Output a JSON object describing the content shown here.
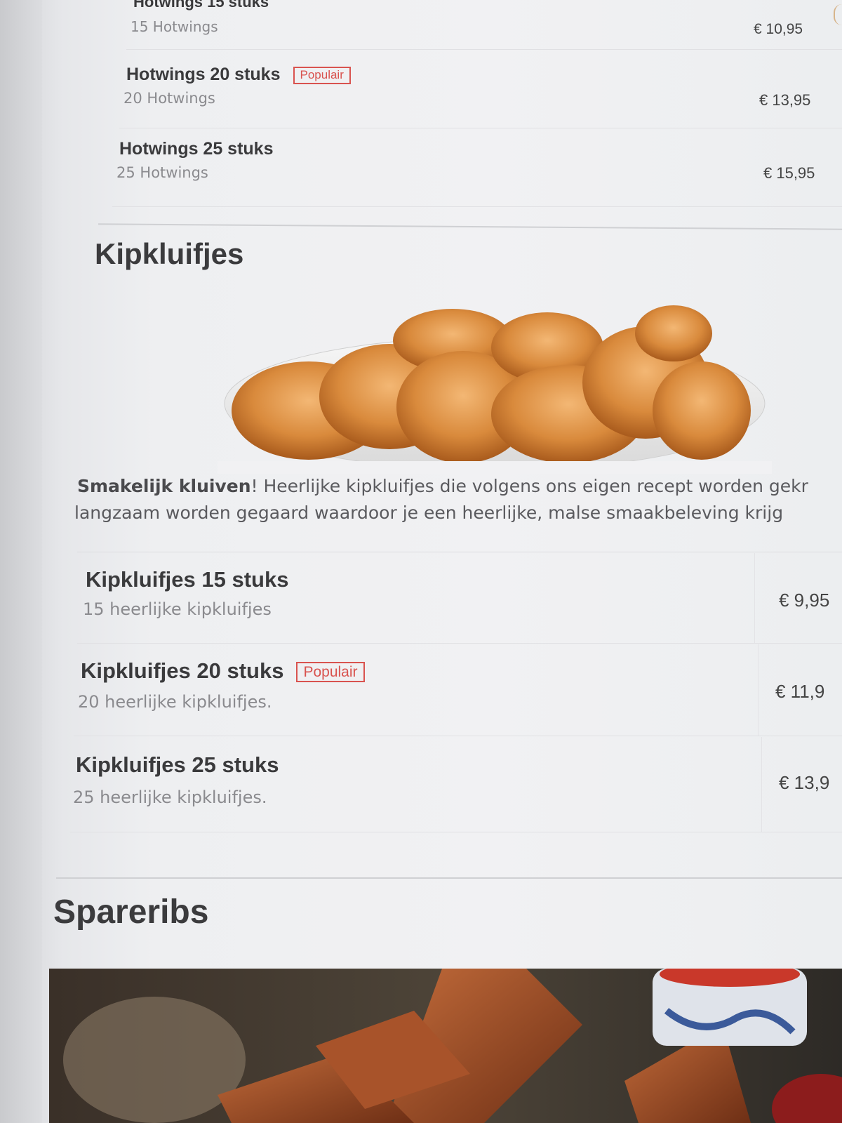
{
  "hotwings": {
    "items": [
      {
        "name": "Hotwings 15 stuks",
        "desc": "15 Hotwings",
        "price": "€ 10,95",
        "badge": ""
      },
      {
        "name": "Hotwings 20 stuks",
        "desc": "20 Hotwings",
        "price": "€ 13,95",
        "badge": "Populair"
      },
      {
        "name": "Hotwings 25 stuks",
        "desc": "25 Hotwings",
        "price": "€ 15,95",
        "badge": ""
      }
    ]
  },
  "kipkluifjes": {
    "title": "Kipkluifjes",
    "intro_bold": "Smakelijk kluiven",
    "intro_line1": "! Heerlijke kipkluifjes die volgens ons eigen recept worden gekr",
    "intro_line2": "langzaam worden gegaard waardoor je een heerlijke, malse smaakbeleving krijg",
    "items": [
      {
        "name": "Kipkluifjes 15 stuks",
        "desc": "15 heerlijke kipkluifjes",
        "price": "€ 9,95",
        "badge": ""
      },
      {
        "name": "Kipkluifjes 20 stuks",
        "desc": "20 heerlijke kipkluifjes.",
        "price": "€ 11,9",
        "badge": "Populair"
      },
      {
        "name": "Kipkluifjes 25 stuks",
        "desc": "25 heerlijke kipkluifjes.",
        "price": "€ 13,9",
        "badge": ""
      }
    ]
  },
  "spareribs": {
    "title": "Spareribs"
  }
}
